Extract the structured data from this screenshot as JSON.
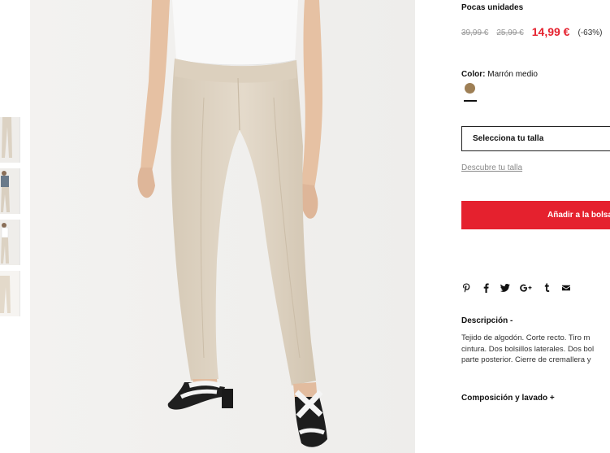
{
  "product": {
    "stock_notice": "Pocas unidades",
    "prices": {
      "original": "39,99 €",
      "previous": "25,99 €",
      "current": "14,99 €",
      "discount": "(-63%)"
    },
    "color": {
      "label": "Color:",
      "value": "Marrón medio",
      "swatch_hex": "#9e7f55"
    },
    "size_select": {
      "label": "Selecciona tu talla"
    },
    "size_guide_link": "Descubre tu talla",
    "add_to_bag": "Añadir a la bolsa",
    "share_icons": [
      "pinterest-icon",
      "facebook-icon",
      "twitter-icon",
      "google-plus-icon",
      "tumblr-icon",
      "email-icon"
    ],
    "description": {
      "title": "Descripción -",
      "lines": [
        "Tejido de algodón. Corte recto. Tiro m",
        "cintura. Dos bolsillos laterales. Dos bol",
        "parte posterior. Cierre de cremallera y"
      ]
    },
    "composition": {
      "title": "Composición y lavado +"
    }
  },
  "colors": {
    "accent": "#e5212e",
    "swatch": "#9e7f55"
  }
}
